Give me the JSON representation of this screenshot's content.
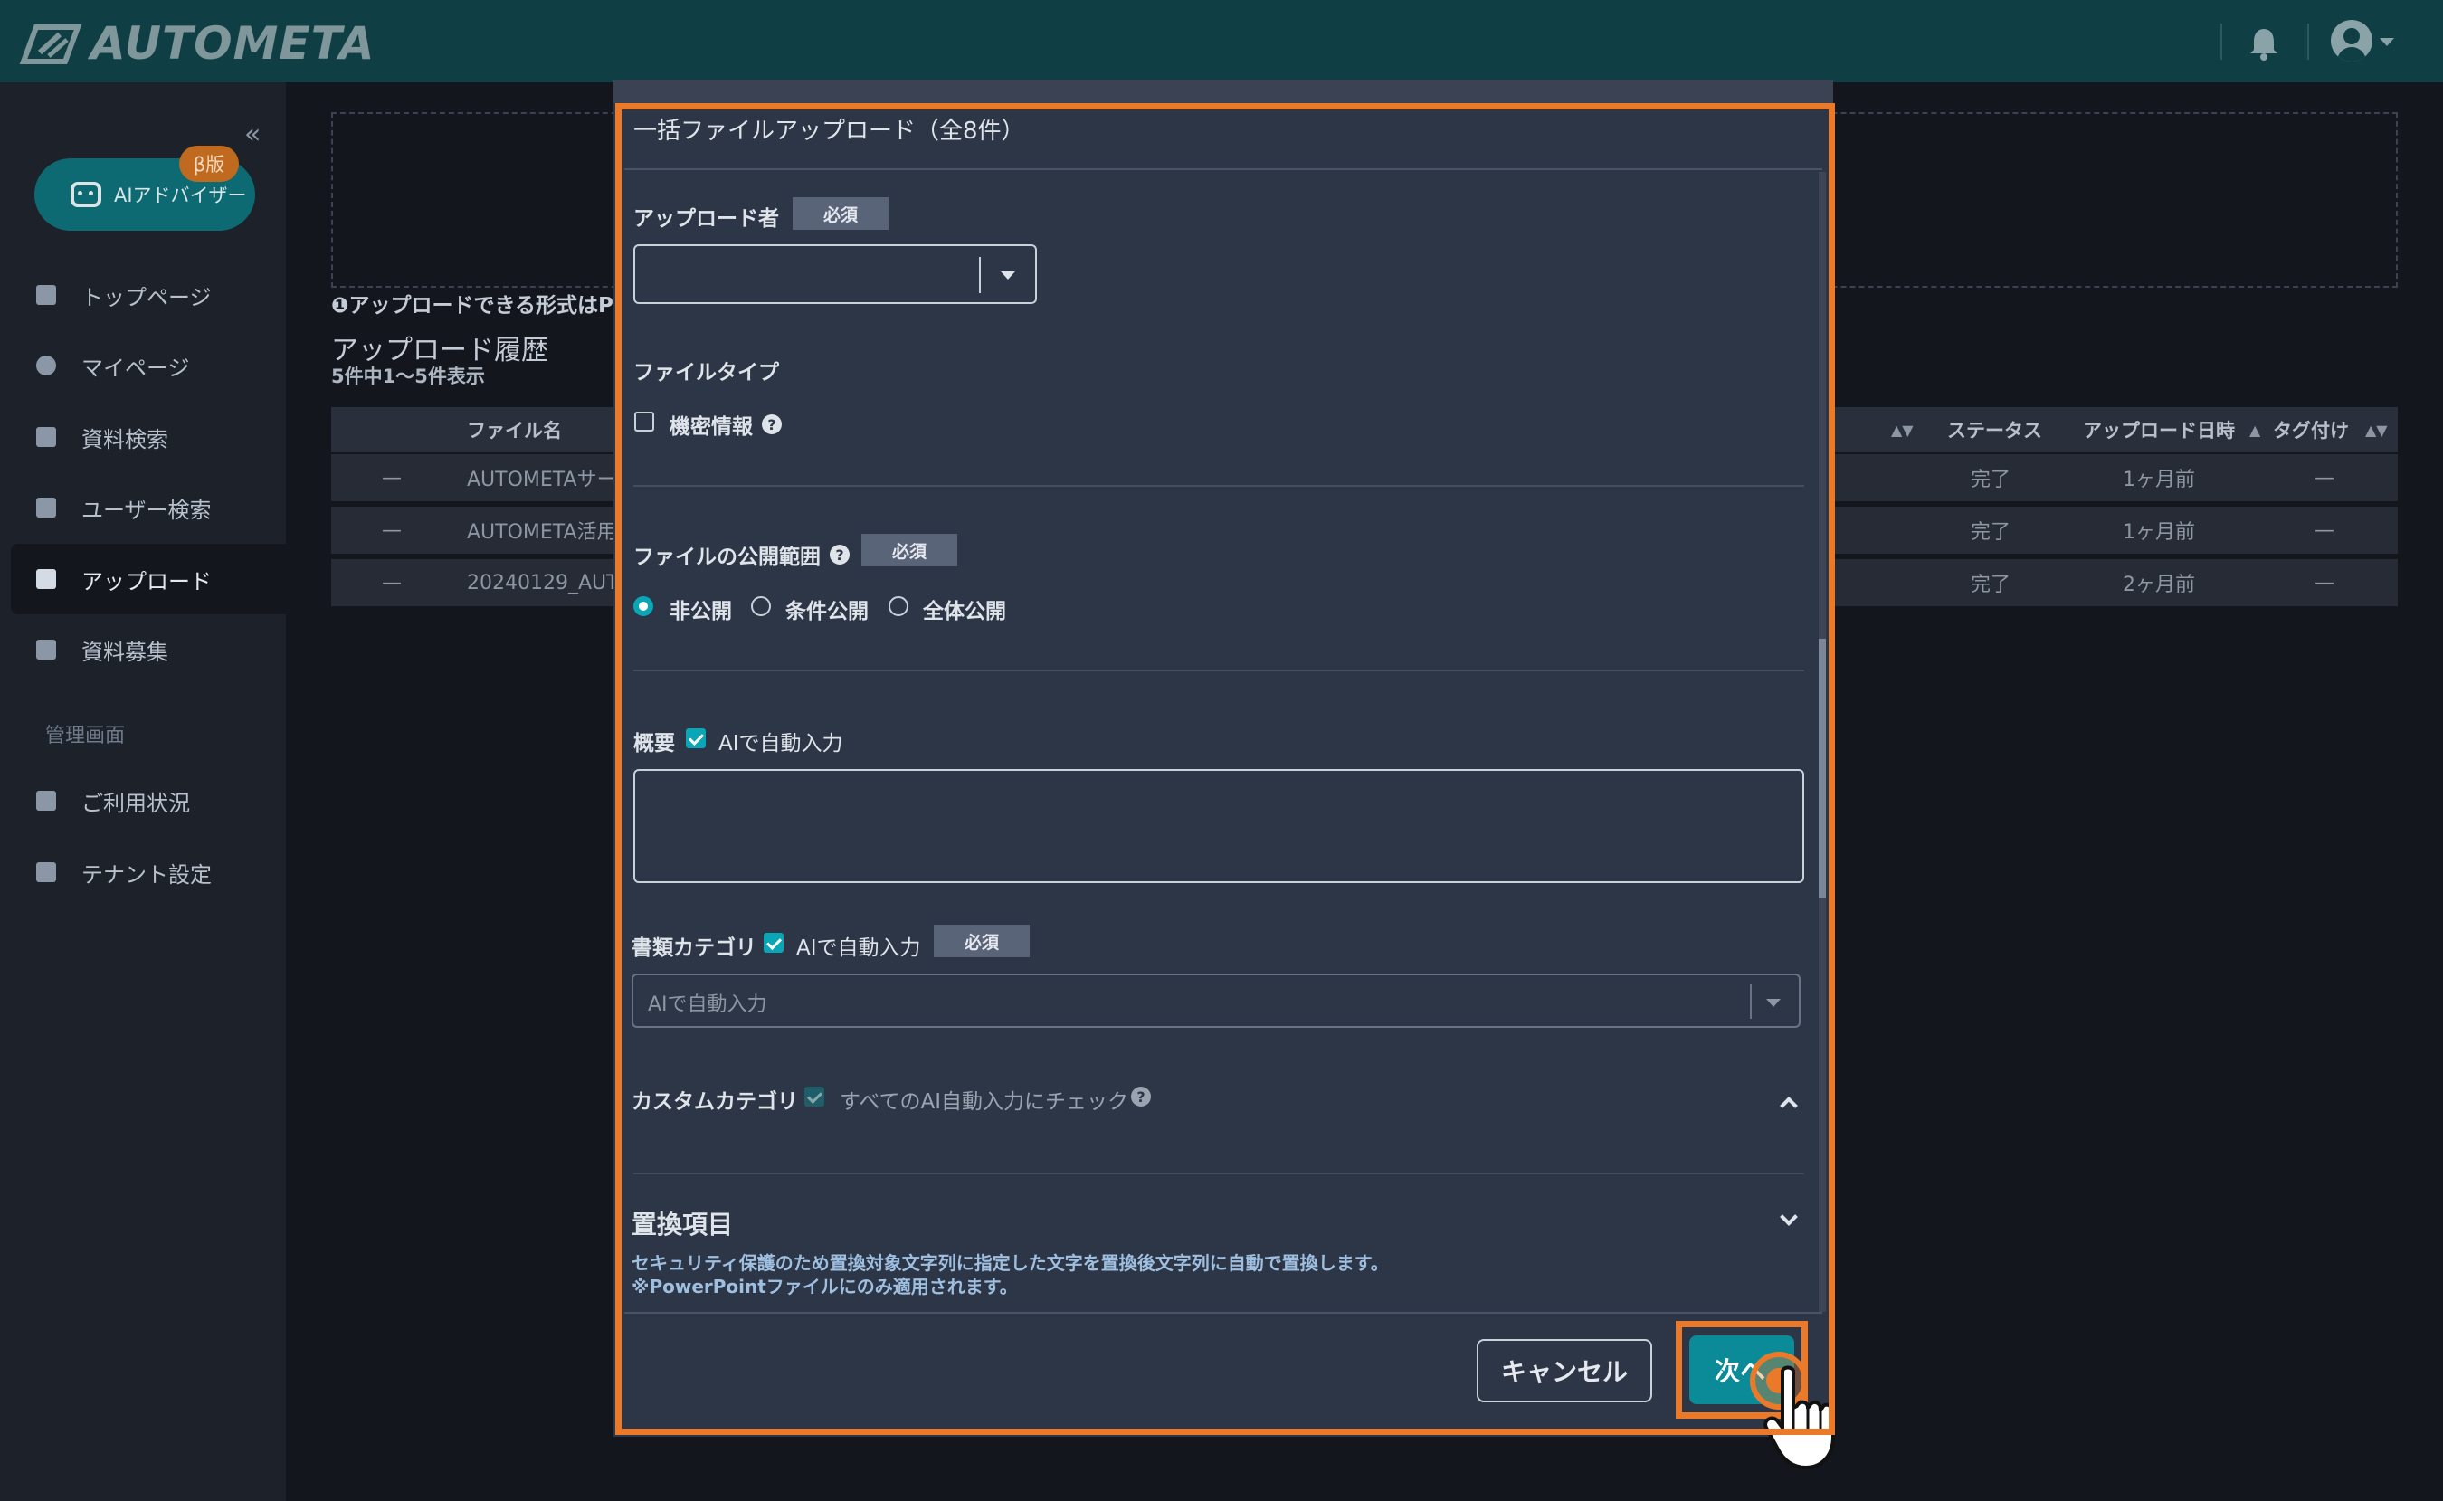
{
  "app": {
    "name": "AUTOMETA"
  },
  "topbar": {
    "icons": [
      "bell-icon",
      "user-avatar-icon"
    ]
  },
  "sidebar": {
    "collapse_label": "«",
    "ai_advisor": {
      "label": "AIアドバイザー",
      "badge": "β版"
    },
    "items": [
      {
        "label": "トップページ",
        "icon": "home-icon"
      },
      {
        "label": "マイページ",
        "icon": "user-icon"
      },
      {
        "label": "資料検索",
        "icon": "document-search-icon"
      },
      {
        "label": "ユーザー検索",
        "icon": "user-search-icon"
      },
      {
        "label": "アップロード",
        "icon": "upload-icon",
        "active": true
      },
      {
        "label": "資料募集",
        "icon": "document-request-icon"
      }
    ],
    "admin_section": "管理画面",
    "admin_items": [
      {
        "label": "ご利用状況",
        "icon": "usage-icon"
      },
      {
        "label": "テナント設定",
        "icon": "tenant-settings-icon"
      }
    ]
  },
  "main": {
    "format_note": "❶アップロードできる形式はP",
    "history_title": "アップロード履歴",
    "history_count": "5件中1〜5件表示",
    "table": {
      "headers": {
        "file_name": "ファイル名",
        "status": "ステータス",
        "upload_date": "アップロード日時",
        "tagging": "タグ付け"
      },
      "rows": [
        {
          "select": "—",
          "file": "AUTOMETAサー",
          "status": "完了",
          "date": "1ヶ月前",
          "tag": "—"
        },
        {
          "select": "—",
          "file": "AUTOMETA活用",
          "status": "完了",
          "date": "1ヶ月前",
          "tag": "—"
        },
        {
          "select": "—",
          "file": "20240129_AUT",
          "status": "完了",
          "date": "2ヶ月前",
          "tag": "—"
        }
      ]
    }
  },
  "modal": {
    "title": "一括ファイルアップロード（全8件）",
    "uploader_label": "アップロード者",
    "required": "必須",
    "uploader_value": "",
    "file_type_label": "ファイルタイプ",
    "confidential_label": "機密情報",
    "scope_label": "ファイルの公開範囲",
    "scope_options": [
      "非公開",
      "条件公開",
      "全体公開"
    ],
    "scope_selected": "非公開",
    "summary_label": "概要",
    "ai_auto_label": "AIで自動入力",
    "summary_value": "",
    "category_label": "書類カテゴリ",
    "category_placeholder": "AIで自動入力",
    "custom_category_label": "カスタムカテゴリ",
    "custom_check_all_label": "すべてのAI自動入力にチェック",
    "replace_title": "置換項目",
    "replace_desc_1": "セキュリティ保護のため置換対象文字列に指定した文字を置換後文字列に自動で置換します。",
    "replace_desc_2": "※PowerPointファイルにのみ適用されます。",
    "cancel_button": "キャンセル",
    "next_button": "次へ"
  },
  "colors": {
    "accent": "#0aa6b5",
    "highlight": "#ea7a2a",
    "topbar": "#0f3f45"
  }
}
